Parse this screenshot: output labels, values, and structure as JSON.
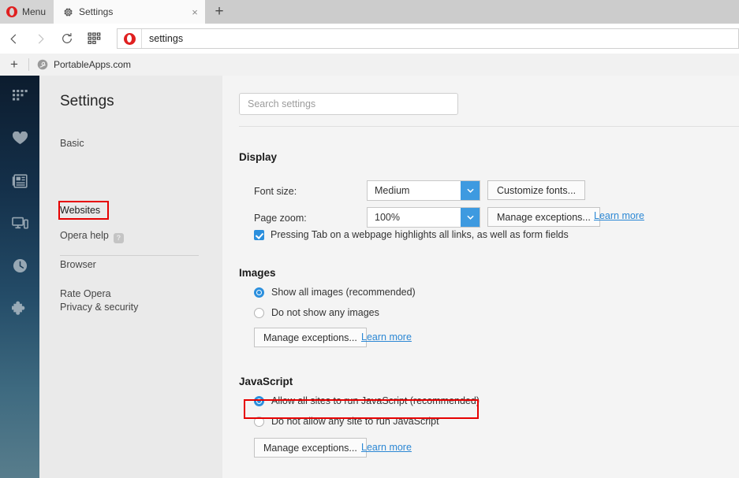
{
  "window": {
    "tabbar": {
      "menu_label": "Menu",
      "menu_icon": "opera-logo-icon",
      "tab": {
        "title": "Settings",
        "icon": "gear-icon",
        "close_icon": "×"
      },
      "new_tab_icon": "+"
    },
    "navbar": {
      "back_icon": "‹",
      "forward_icon": "›",
      "reload_icon": "reload-icon",
      "speeddial_icon": "speed-dial-grid-icon",
      "address_value": "settings",
      "address_badge_icon": "opera-logo-icon"
    },
    "bookmarkbar": {
      "add_icon": "+",
      "items": [
        {
          "label": "PortableApps.com",
          "icon": "portableapps-icon"
        }
      ]
    }
  },
  "rail": {
    "items": [
      {
        "name": "speed-dial",
        "icon": "grid-icon"
      },
      {
        "name": "bookmarks",
        "icon": "heart-icon"
      },
      {
        "name": "news",
        "icon": "news-icon"
      },
      {
        "name": "my-flow",
        "icon": "devices-icon"
      },
      {
        "name": "history",
        "icon": "clock-icon"
      },
      {
        "name": "extensions",
        "icon": "puzzle-icon"
      }
    ]
  },
  "settings_nav": {
    "heading": "Settings",
    "basic": "Basic",
    "browser": "Browser",
    "websites": "Websites",
    "privacy": "Privacy & security",
    "opera_help": "Opera help",
    "help_icon": "?",
    "rate_opera": "Rate Opera"
  },
  "search": {
    "placeholder": "Search settings",
    "value": ""
  },
  "sections": {
    "display": {
      "title": "Display",
      "font_size_label": "Font size:",
      "font_size_value": "Medium",
      "customize_fonts_button": "Customize fonts...",
      "page_zoom_label": "Page zoom:",
      "page_zoom_value": "100%",
      "zoom_exceptions_button": "Manage exceptions...",
      "zoom_learn_more": "Learn more",
      "tab_highlight_checkbox": "Pressing Tab on a webpage highlights all links, as well as form fields"
    },
    "images": {
      "title": "Images",
      "option_show": "Show all images (recommended)",
      "option_hide": "Do not show any images",
      "exceptions_button": "Manage exceptions...",
      "learn_more": "Learn more"
    },
    "javascript": {
      "title": "JavaScript",
      "option_allow": "Allow all sites to run JavaScript (recommended)",
      "option_deny": "Do not allow any site to run JavaScript",
      "exceptions_button": "Manage exceptions...",
      "learn_more": "Learn more"
    }
  },
  "annotations": {
    "color": "#e60000",
    "targets": [
      "websites-nav-link",
      "allow-javascript-radio-option"
    ]
  },
  "colors": {
    "accent_blue": "#2b8fdd",
    "link_blue": "#2b87d4",
    "dropdown_blue": "#3e9ae0",
    "rail_top": "#0c1c2e",
    "rail_bottom": "#587d8c",
    "annotation_red": "#e60000"
  }
}
